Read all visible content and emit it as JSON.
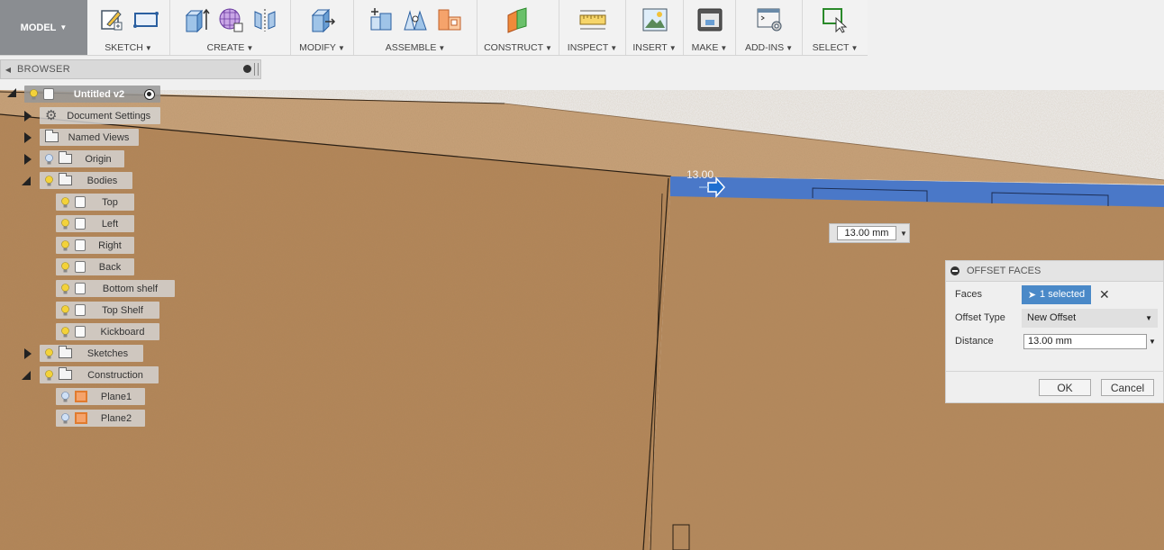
{
  "toolbar": {
    "model": "MODEL",
    "groups": [
      {
        "label": "SKETCH"
      },
      {
        "label": "CREATE"
      },
      {
        "label": "MODIFY"
      },
      {
        "label": "ASSEMBLE"
      },
      {
        "label": "CONSTRUCT"
      },
      {
        "label": "INSPECT"
      },
      {
        "label": "INSERT"
      },
      {
        "label": "MAKE"
      },
      {
        "label": "ADD-INS"
      },
      {
        "label": "SELECT"
      }
    ]
  },
  "browser": {
    "title": "BROWSER",
    "root": "Untitled v2",
    "document_settings": "Document Settings",
    "named_views": "Named Views",
    "origin": "Origin",
    "bodies": "Bodies",
    "body_items": [
      "Top",
      "Left",
      "Right",
      "Back",
      "Bottom shelf",
      "Top Shelf",
      "Kickboard"
    ],
    "sketches": "Sketches",
    "construction": "Construction",
    "planes": [
      "Plane1",
      "Plane2"
    ]
  },
  "canvas": {
    "dimension_label": "13.00",
    "dimension_input": "13.00 mm"
  },
  "dialog": {
    "title": "OFFSET FACES",
    "faces_label": "Faces",
    "faces_value": "1 selected",
    "offset_type_label": "Offset Type",
    "offset_type_value": "New Offset",
    "distance_label": "Distance",
    "distance_value": "13.00 mm",
    "ok": "OK",
    "cancel": "Cancel"
  },
  "colors": {
    "wood": "#b5875b",
    "wood_top": "#c9a47b",
    "selected_face": "#4a78c8",
    "accent": "#4a89c8"
  }
}
